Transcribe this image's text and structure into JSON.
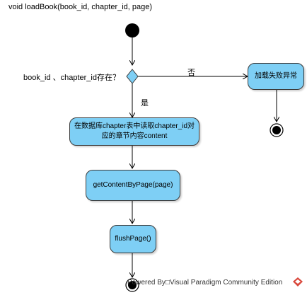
{
  "title": "void loadBook(book_id, chapter_id, page)",
  "decision": {
    "question": "book_id 、chapter_id存在？",
    "no_label": "否",
    "yes_label": "是"
  },
  "nodes": {
    "load_failed": "加载失败异常",
    "read_chapter": "在数据库chapter表中读取chapter_id对应的章节内容content",
    "get_content": "getContentByPage(page)",
    "flush_page": "flushPage()"
  },
  "footer": "Powered By□Visual Paradigm Community Edition",
  "colors": {
    "node_fill": "#7ecff5",
    "logo": "#d9473b"
  }
}
